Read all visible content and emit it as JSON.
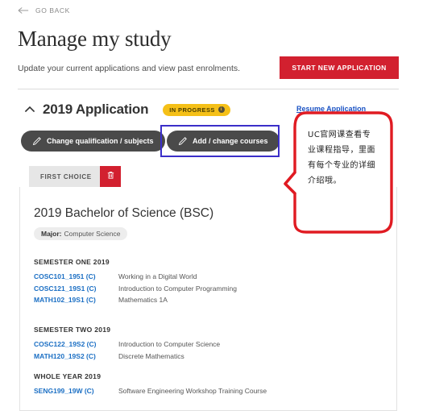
{
  "nav": {
    "go_back_label": "GO BACK",
    "go_back_icon": "arrow-left-icon"
  },
  "header": {
    "title": "Manage my study",
    "subtitle": "Update your current applications and view past enrolments.",
    "start_button_label": "START NEW APPLICATION"
  },
  "application": {
    "collapse_icon": "chevron-up-icon",
    "title": "2019 Application",
    "status_badge": "IN PROGRESS",
    "status_info_icon": "info-icon",
    "resume_link_label": "Resume Application",
    "buttons": [
      {
        "label": "Change qualification / subjects",
        "icon": "pencil-icon"
      },
      {
        "label": "Add / change courses",
        "icon": "pencil-icon"
      }
    ]
  },
  "choice": {
    "tab_label": "FIRST CHOICE",
    "delete_icon": "trash-icon"
  },
  "qualification": {
    "title": "2019 Bachelor of Science (BSC)",
    "major_label": "Major:",
    "major_value": "Computer Science"
  },
  "semesters": [
    {
      "title": "SEMESTER ONE 2019",
      "courses": [
        {
          "code": "COSC101_1951 (C)",
          "name": "Working in a Digital World"
        },
        {
          "code": "COSC121_19S1 (C)",
          "name": "Introduction to Computer Programming"
        },
        {
          "code": "MATH102_19S1 (C)",
          "name": "Mathematics 1A"
        }
      ]
    },
    {
      "title": "SEMESTER TWO 2019",
      "courses": [
        {
          "code": "COSC122_19S2 (C)",
          "name": "Introduction to Computer Science"
        },
        {
          "code": "MATH120_19S2 (C)",
          "name": "Discrete Mathematics"
        }
      ]
    },
    {
      "title": "WHOLE YEAR 2019",
      "courses": [
        {
          "code": "SENG199_19W (C)",
          "name": "Software Engineering Workshop Training Course"
        }
      ]
    }
  ],
  "annotation": {
    "text": "UC官网课查看专业课程指导，里面有每个专业的详细介绍哦。",
    "box_color": "#e01b22",
    "highlight_color": "#3b2fc9"
  },
  "colors": {
    "brand_red": "#d2202f",
    "link_blue": "#1b6fc4",
    "status_yellow": "#f5c018",
    "button_dark": "#4a4a4a"
  }
}
